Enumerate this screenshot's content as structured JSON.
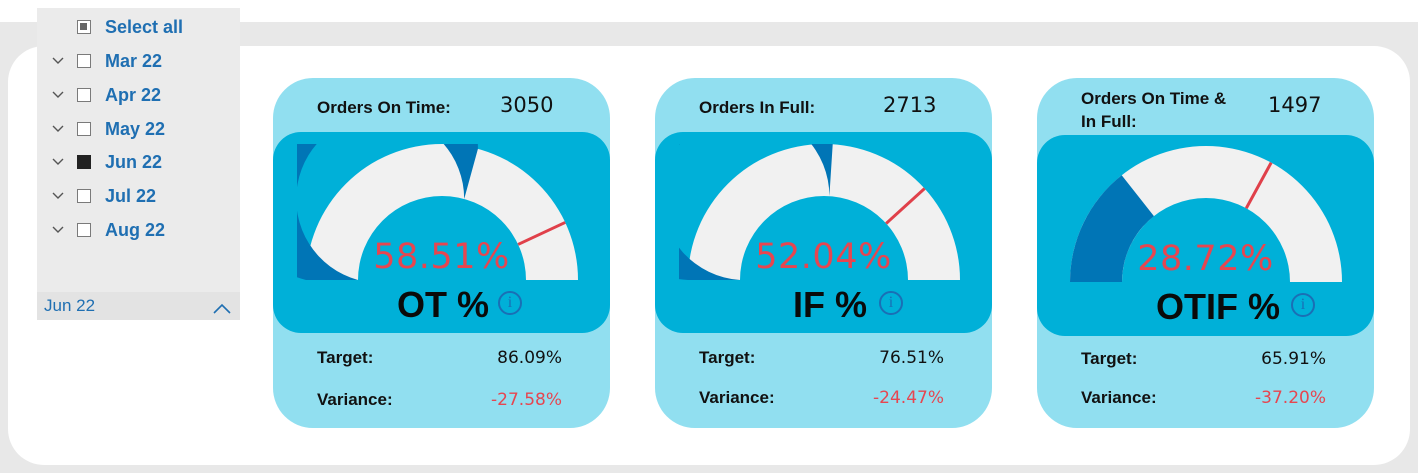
{
  "slicer": {
    "select_all_label": "Select all",
    "items": [
      {
        "label": "Mar 22",
        "checked": false
      },
      {
        "label": "Apr 22",
        "checked": false
      },
      {
        "label": "May 22",
        "checked": false
      },
      {
        "label": "Jun 22",
        "checked": true
      },
      {
        "label": "Jul 22",
        "checked": false
      },
      {
        "label": "Aug 22",
        "checked": false
      }
    ],
    "selected_summary": "Jun 22"
  },
  "cards": [
    {
      "header_label": "Orders On Time:",
      "header_value": "3050",
      "percent_text": "58.51%",
      "value_fraction": 0.5851,
      "target_fraction": 0.8609,
      "metric_label": "OT %",
      "target_label": "Target:",
      "target_value": "86.09%",
      "variance_label": "Variance:",
      "variance_value": "-27.58%"
    },
    {
      "header_label": "Orders In Full:",
      "header_value": "2713",
      "percent_text": "52.04%",
      "value_fraction": 0.5204,
      "target_fraction": 0.7651,
      "metric_label": "IF %",
      "target_label": "Target:",
      "target_value": "76.51%",
      "variance_label": "Variance:",
      "variance_value": "-24.47%"
    },
    {
      "header_label_line1": "Orders On Time &",
      "header_label_line2": "In Full:",
      "header_value": "1497",
      "percent_text": "28.72%",
      "value_fraction": 0.2872,
      "target_fraction": 0.6591,
      "metric_label": "OTIF %",
      "target_label": "Target:",
      "target_value": "65.91%",
      "variance_label": "Variance:",
      "variance_value": "-37.20%"
    }
  ],
  "colors": {
    "gauge_fill": "#0075b6",
    "gauge_track": "#f1f1f1",
    "target_marker": "#e0404a",
    "card_outer": "#91dff0",
    "card_inner": "#00b0d8",
    "negative_text": "#e64650",
    "slicer_text": "#1f6fb2"
  },
  "icons": [
    "chevron-down-icon",
    "chevron-up-icon",
    "info-icon",
    "checkbox-icon"
  ]
}
